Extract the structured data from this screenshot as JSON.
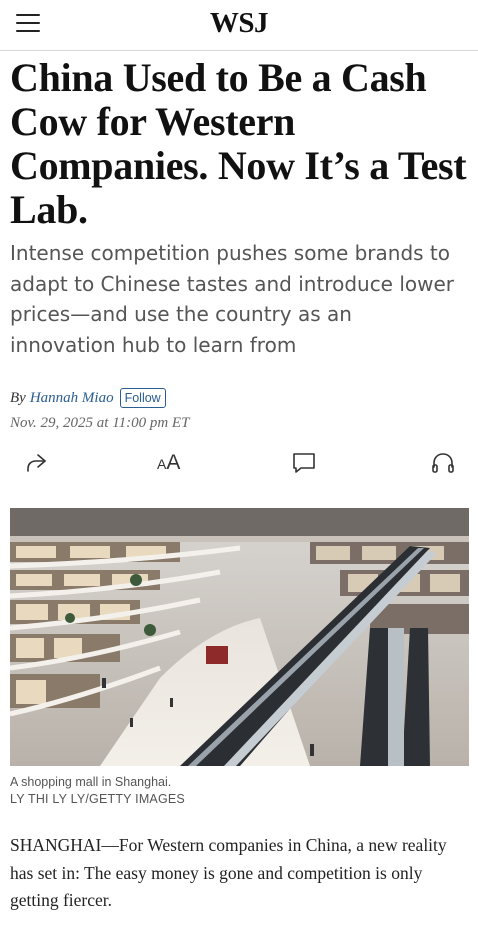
{
  "header": {
    "logo": "WSJ",
    "menu_icon": "hamburger-menu-icon"
  },
  "article": {
    "headline": "China Used to Be a Cash Cow for Western Companies. Now It’s a Test Lab.",
    "dek": "Intense competition pushes some brands to adapt to Chinese tastes and introduce lower prices—and use the country as an innovation hub to learn from",
    "byline_prefix": "By",
    "author": "Hannah Miao",
    "follow_label": "Follow",
    "date": "Nov. 29, 2025 at 11:00 pm ET",
    "tools": {
      "share_icon": "share-icon",
      "text_size_label": "AA",
      "text_size_small": "A",
      "text_size_big": "A",
      "comment_icon": "comment-icon",
      "listen_icon": "headphones-icon"
    },
    "image": {
      "caption": "A shopping mall in Shanghai.",
      "credit": "LY THI LY LY/GETTY IMAGES"
    },
    "body_first_paragraph": "SHANGHAI—For Western companies in China, a new reality has set in: The easy money is gone and competition is only getting fiercer."
  },
  "colors": {
    "link_blue": "#2a5d94",
    "dek_gray": "#555555",
    "divider": "#d6d6d6"
  }
}
